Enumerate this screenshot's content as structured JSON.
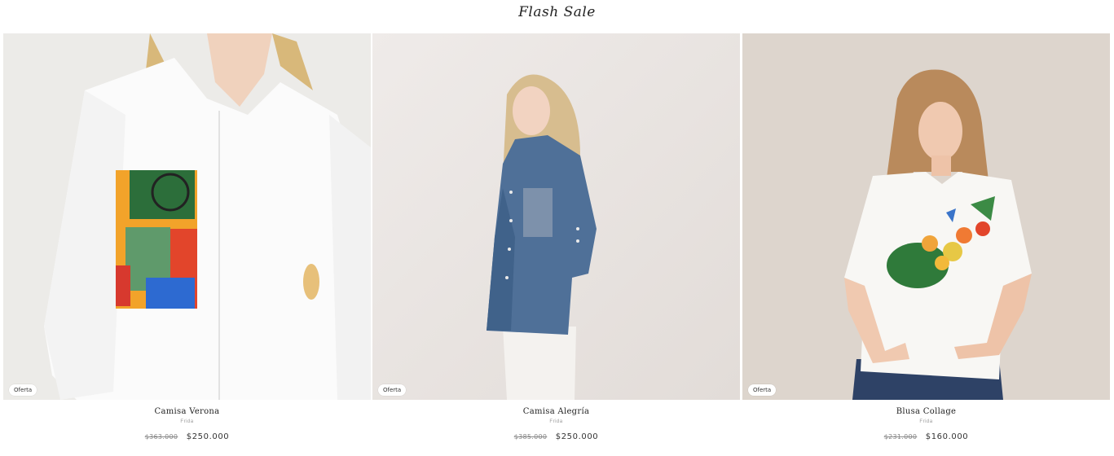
{
  "section": {
    "title": "Flash Sale"
  },
  "products": [
    {
      "name": "Camisa Verona",
      "vendor": "Frida",
      "badge": "Oferta",
      "price_old": "$363.000",
      "price_new": "$250.000",
      "image_alt": "Woman wearing white shirt with colorful patchwork pocket"
    },
    {
      "name": "Camisa Alegría",
      "vendor": "Frida",
      "badge": "Oferta",
      "price_old": "$385.000",
      "price_new": "$250.000",
      "image_alt": "Woman wearing blue denim shirt"
    },
    {
      "name": "Blusa Collage",
      "vendor": "Frida",
      "badge": "Oferta",
      "price_old": "$231.000",
      "price_new": "$160.000",
      "image_alt": "Woman wearing white blouse with tropical print"
    }
  ],
  "colors": {
    "bg1": "#ecebe8",
    "bg2": "#e8e4e1",
    "bg3": "#ddd5cd",
    "denim": "#4f7098",
    "navy_skirt": "#2e4266"
  }
}
